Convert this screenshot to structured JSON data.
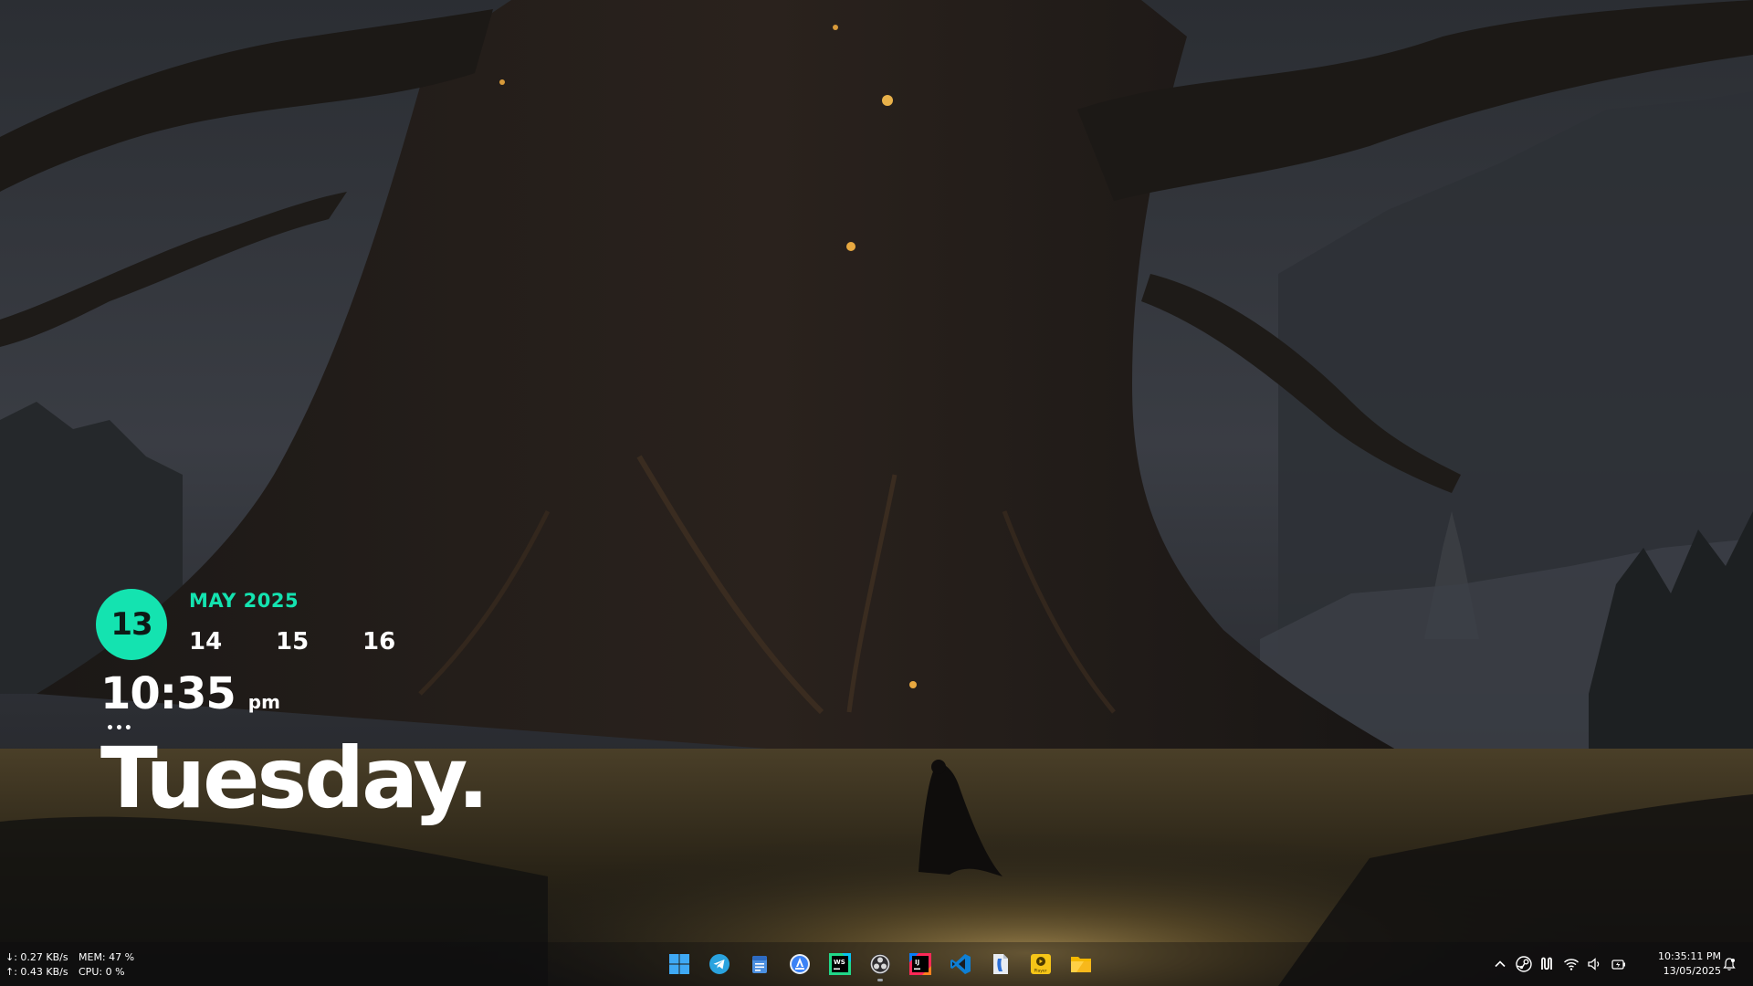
{
  "calendar": {
    "day": "13",
    "month_year": "MAY 2025",
    "next_days": [
      "14",
      "15",
      "16"
    ],
    "time": "10:35",
    "ampm": "pm",
    "dots": "•••",
    "weekday": "Tuesday."
  },
  "net_stats": {
    "down": "↓: 0.27 KB/s",
    "up": "↑: 0.43 KB/s",
    "mem": "MEM: 47 %",
    "cpu": "CPU: 0 %"
  },
  "taskbar": {
    "apps": [
      {
        "name": "start",
        "icon": "windows-logo-icon",
        "running": false
      },
      {
        "name": "telegram",
        "icon": "telegram-icon",
        "running": false
      },
      {
        "name": "notepad",
        "icon": "notepad-icon",
        "running": false
      },
      {
        "name": "app-store",
        "icon": "app-store-icon",
        "running": false
      },
      {
        "name": "webstorm",
        "icon": "webstorm-icon",
        "running": false
      },
      {
        "name": "obs",
        "icon": "obs-icon",
        "running": true
      },
      {
        "name": "intellij",
        "icon": "intellij-icon",
        "running": false
      },
      {
        "name": "vscode",
        "icon": "vscode-icon",
        "running": false
      },
      {
        "name": "word-document",
        "icon": "document-icon",
        "running": false
      },
      {
        "name": "player",
        "icon": "player-icon",
        "running": false
      },
      {
        "name": "file-explorer",
        "icon": "folder-icon",
        "running": false
      }
    ],
    "player_label": "Player",
    "webstorm_label": "WS",
    "intellij_label": "IJ"
  },
  "tray": {
    "icons": [
      "chevron-up-icon",
      "steam-icon",
      "notion-icon",
      "wifi-icon",
      "volume-icon",
      "battery-icon"
    ]
  },
  "clock": {
    "time": "10:35:11 PM",
    "date": "13/05/2025"
  },
  "colors": {
    "accent": "#14e3b0",
    "text": "#ffffff"
  }
}
